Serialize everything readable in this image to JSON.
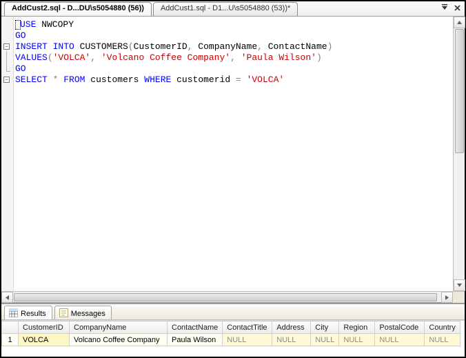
{
  "tabs": [
    {
      "label": "AddCust2.sql - D...DU\\s5054880 (56))",
      "active": true
    },
    {
      "label": "AddCust1.sql - D1...U\\s5054880 (53))*",
      "active": false
    }
  ],
  "code": {
    "lines": [
      {
        "tokens": [
          {
            "cls": "cursor"
          },
          {
            "cls": "kw",
            "t": "USE"
          },
          {
            "cls": "",
            "t": " NWCOPY"
          }
        ]
      },
      {
        "tokens": [
          {
            "cls": "kw",
            "t": "GO"
          }
        ]
      },
      {
        "tokens": [
          {
            "cls": "kw",
            "t": "INSERT"
          },
          {
            "cls": "",
            "t": " "
          },
          {
            "cls": "kw",
            "t": "INTO"
          },
          {
            "cls": "",
            "t": " CUSTOMERS"
          },
          {
            "cls": "op",
            "t": "("
          },
          {
            "cls": "",
            "t": "CustomerID"
          },
          {
            "cls": "op",
            "t": ","
          },
          {
            "cls": "",
            "t": " CompanyName"
          },
          {
            "cls": "op",
            "t": ","
          },
          {
            "cls": "",
            "t": " ContactName"
          },
          {
            "cls": "op",
            "t": ")"
          }
        ]
      },
      {
        "tokens": [
          {
            "cls": "kw",
            "t": "VALUES"
          },
          {
            "cls": "op",
            "t": "("
          },
          {
            "cls": "str",
            "t": "'VOLCA'"
          },
          {
            "cls": "op",
            "t": ","
          },
          {
            "cls": "",
            "t": " "
          },
          {
            "cls": "str",
            "t": "'Volcano Coffee Company'"
          },
          {
            "cls": "op",
            "t": ","
          },
          {
            "cls": "",
            "t": " "
          },
          {
            "cls": "str",
            "t": "'Paula Wilson'"
          },
          {
            "cls": "op",
            "t": ")"
          }
        ]
      },
      {
        "tokens": [
          {
            "cls": "kw",
            "t": "GO"
          }
        ]
      },
      {
        "tokens": [
          {
            "cls": "kw",
            "t": "SELECT"
          },
          {
            "cls": "",
            "t": " "
          },
          {
            "cls": "op",
            "t": "*"
          },
          {
            "cls": "",
            "t": " "
          },
          {
            "cls": "kw",
            "t": "FROM"
          },
          {
            "cls": "",
            "t": " customers "
          },
          {
            "cls": "kw",
            "t": "WHERE"
          },
          {
            "cls": "",
            "t": " customerid "
          },
          {
            "cls": "op",
            "t": "="
          },
          {
            "cls": "",
            "t": " "
          },
          {
            "cls": "str",
            "t": "'VOLCA'"
          }
        ]
      },
      {
        "tokens": []
      }
    ],
    "fold_regions": [
      {
        "start": 2,
        "end": 4
      },
      {
        "start": 5,
        "end": 5
      }
    ]
  },
  "resultsTabs": {
    "results": "Results",
    "messages": "Messages"
  },
  "grid": {
    "columns": [
      "CustomerID",
      "CompanyName",
      "ContactName",
      "ContactTitle",
      "Address",
      "City",
      "Region",
      "PostalCode",
      "Country"
    ],
    "widths": [
      74,
      142,
      78,
      72,
      56,
      40,
      52,
      72,
      52
    ],
    "rows": [
      {
        "n": "1",
        "cells": [
          {
            "v": "VOLCA",
            "null": false,
            "sel": true
          },
          {
            "v": "Volcano Coffee Company",
            "null": false
          },
          {
            "v": "Paula Wilson",
            "null": false
          },
          {
            "v": "NULL",
            "null": true
          },
          {
            "v": "NULL",
            "null": true
          },
          {
            "v": "NULL",
            "null": true
          },
          {
            "v": "NULL",
            "null": true
          },
          {
            "v": "NULL",
            "null": true
          },
          {
            "v": "NULL",
            "null": true
          }
        ]
      }
    ]
  }
}
